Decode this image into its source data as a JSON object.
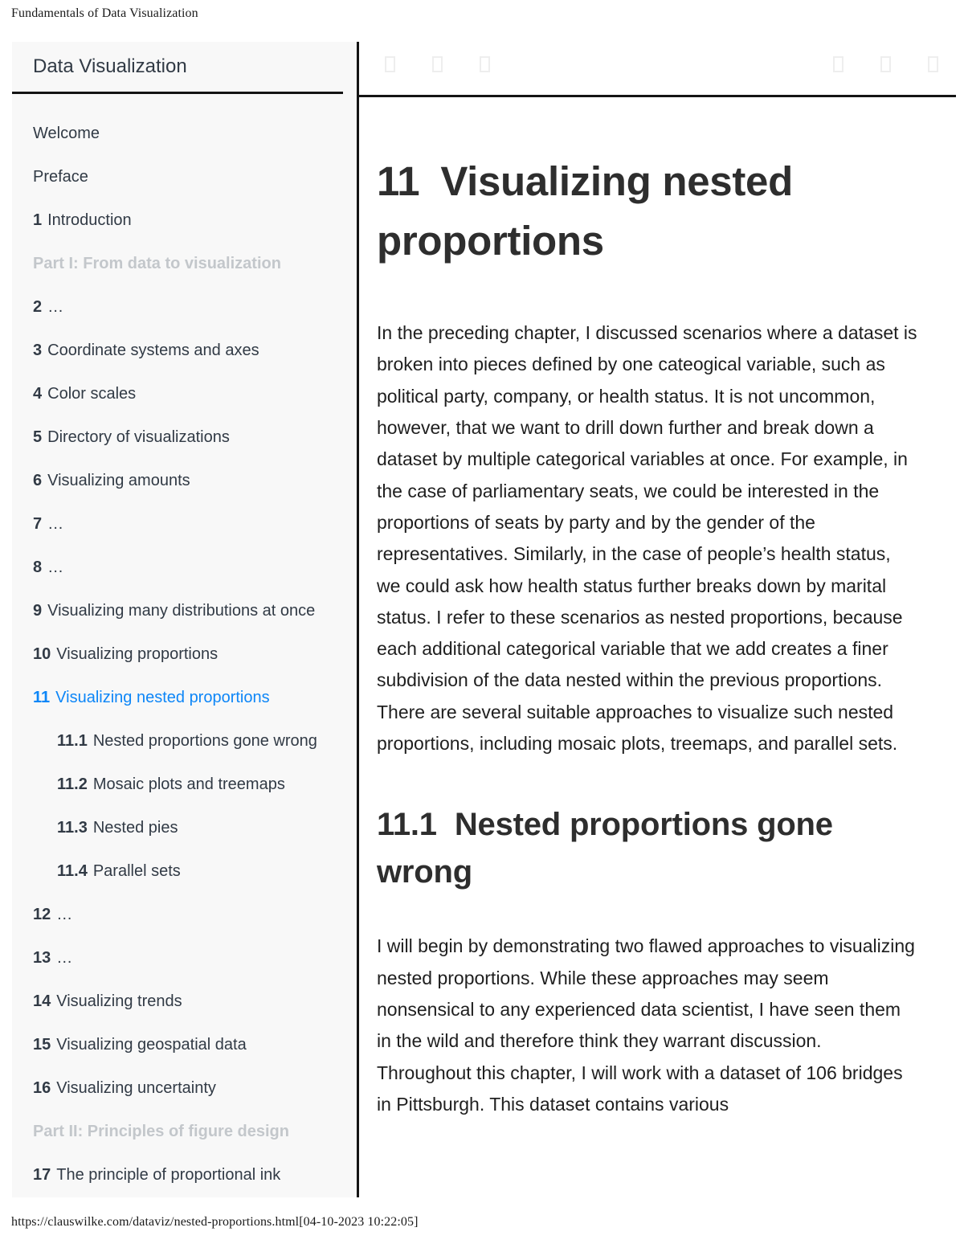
{
  "print": {
    "header": "Fundamentals of Data Visualization",
    "footer": "https://clauswilke.com/dataviz/nested-proportions.html[04-10-2023 10:22:05]"
  },
  "colors": {
    "accent": "#0d86f7",
    "sidebar_bg": "#f8f8f8",
    "text": "#313a45",
    "muted": "#c3c7cb",
    "rule": "#141414"
  },
  "sidebar": {
    "title": "Data Visualization",
    "items": [
      {
        "num": "",
        "label": "Welcome",
        "type": "chapter",
        "active": false
      },
      {
        "num": "",
        "label": "Preface",
        "type": "chapter",
        "active": false
      },
      {
        "num": "1",
        "label": "Introduction",
        "type": "chapter",
        "active": false
      },
      {
        "num": "",
        "label": "Part I: From data to visualization",
        "type": "part",
        "active": false
      },
      {
        "num": "2",
        "label": "…",
        "type": "chapter",
        "active": false
      },
      {
        "num": "3",
        "label": "Coordinate systems and axes",
        "type": "chapter",
        "active": false
      },
      {
        "num": "4",
        "label": "Color scales",
        "type": "chapter",
        "active": false
      },
      {
        "num": "5",
        "label": "Directory of visualizations",
        "type": "chapter",
        "active": false
      },
      {
        "num": "6",
        "label": "Visualizing amounts",
        "type": "chapter",
        "active": false
      },
      {
        "num": "7",
        "label": "…",
        "type": "chapter",
        "active": false
      },
      {
        "num": "8",
        "label": "…",
        "type": "chapter",
        "active": false
      },
      {
        "num": "9",
        "label": "Visualizing many distributions at once",
        "type": "chapter",
        "active": false
      },
      {
        "num": "10",
        "label": "Visualizing proportions",
        "type": "chapter",
        "active": false
      },
      {
        "num": "11",
        "label": "Visualizing nested proportions",
        "type": "chapter",
        "active": true
      },
      {
        "num": "11.1",
        "label": "Nested proportions gone wrong",
        "type": "sub",
        "active": false
      },
      {
        "num": "11.2",
        "label": "Mosaic plots and treemaps",
        "type": "sub",
        "active": false
      },
      {
        "num": "11.3",
        "label": "Nested pies",
        "type": "sub",
        "active": false
      },
      {
        "num": "11.4",
        "label": "Parallel sets",
        "type": "sub",
        "active": false
      },
      {
        "num": "12",
        "label": "…",
        "type": "chapter",
        "active": false
      },
      {
        "num": "13",
        "label": "…",
        "type": "chapter",
        "active": false
      },
      {
        "num": "14",
        "label": "Visualizing trends",
        "type": "chapter",
        "active": false
      },
      {
        "num": "15",
        "label": "Visualizing geospatial data",
        "type": "chapter",
        "active": false
      },
      {
        "num": "16",
        "label": "Visualizing uncertainty",
        "type": "chapter",
        "active": false
      },
      {
        "num": "",
        "label": "Part II: Principles of figure design",
        "type": "part",
        "active": false
      },
      {
        "num": "17",
        "label": "The principle of proportional ink",
        "type": "chapter",
        "active": false
      }
    ]
  },
  "toolbar": {
    "left_icons": [
      {
        "name": "missing-glyph-icon-1"
      },
      {
        "name": "missing-glyph-icon-2"
      },
      {
        "name": "missing-glyph-icon-3"
      }
    ],
    "right_icons": [
      {
        "name": "missing-glyph-icon-4"
      },
      {
        "name": "missing-glyph-icon-5"
      },
      {
        "name": "missing-glyph-icon-6"
      }
    ]
  },
  "content": {
    "chapter_number": "11",
    "chapter_title": "Visualizing nested proportions",
    "intro_paragraph": "In the preceding chapter, I discussed scenarios where a dataset is broken into pieces defined by one cateogical variable, such as political party, company, or health status. It is not uncommon, however, that we want to drill down further and break down a dataset by multiple categorical variables at once. For example, in the case of parliamentary seats, we could be interested in the proportions of seats by party and by the gender of the representatives. Similarly, in the case of people’s health status, we could ask how health status further breaks down by marital status. I refer to these scenarios as nested proportions, because each additional categorical variable that we add creates a finer subdivision of the data nested within the previous proportions. There are several suitable approaches to visualize such nested proportions, including mosaic plots, treemaps, and parallel sets.",
    "section_number": "11.1",
    "section_title": "Nested proportions gone wrong",
    "section_paragraph": "I will begin by demonstrating two flawed approaches to visualizing nested proportions. While these approaches may seem nonsensical to any experienced data scientist, I have seen them in the wild and therefore think they warrant discussion. Throughout this chapter, I will work with a dataset of 106 bridges in Pittsburgh. This dataset contains various"
  }
}
